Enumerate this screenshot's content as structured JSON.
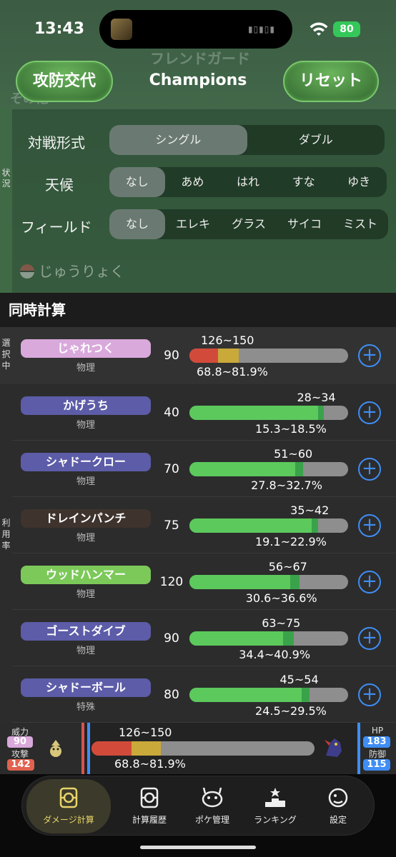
{
  "status_bar": {
    "time": "13:43",
    "battery": "80"
  },
  "background_ghost": {
    "line1": "フレンドガード",
    "line2": "その他"
  },
  "header": {
    "swap_label": "攻防交代",
    "title": "Champions",
    "reset_label": "リセット"
  },
  "conditions": {
    "side_label": "状況",
    "battle_format": {
      "label": "対戦形式",
      "options": [
        "シングル",
        "ダブル"
      ],
      "selected": "シングル"
    },
    "weather": {
      "label": "天候",
      "options": [
        "なし",
        "あめ",
        "はれ",
        "すな",
        "ゆき"
      ],
      "selected": "なし"
    },
    "field": {
      "label": "フィールド",
      "options": [
        "なし",
        "エレキ",
        "グラス",
        "サイコ",
        "ミスト"
      ],
      "selected": "なし"
    },
    "gravity_label": "じゅうりょく"
  },
  "calc": {
    "title": "同時計算",
    "selected_label": "選択中",
    "usage_label": "利用率",
    "selected_move": {
      "name": "じゃれつく",
      "category": "物理",
      "power": "90",
      "range": "126~150",
      "percent": "68.8~81.9%",
      "min_frac": 0.188,
      "max_frac": 0.214,
      "color": "#d9a9db",
      "min_color": "#d24b3a",
      "max_color": "#c9a93a"
    },
    "moves": [
      {
        "name": "かげうち",
        "category": "物理",
        "power": "40",
        "range": "28~34",
        "percent": "15.3~18.5%",
        "min_frac": 0.813,
        "max_frac": 0.846,
        "color": "#5c5ca8"
      },
      {
        "name": "シャドークロー",
        "category": "物理",
        "power": "70",
        "range": "51~60",
        "percent": "27.8~32.7%",
        "min_frac": 0.667,
        "max_frac": 0.716,
        "color": "#5c5ca8"
      },
      {
        "name": "ドレインパンチ",
        "category": "物理",
        "power": "75",
        "range": "35~42",
        "percent": "19.1~22.9%",
        "min_frac": 0.771,
        "max_frac": 0.809,
        "color": "#3e332d"
      },
      {
        "name": "ウッドハンマー",
        "category": "物理",
        "power": "120",
        "range": "56~67",
        "percent": "30.6~36.6%",
        "min_frac": 0.634,
        "max_frac": 0.694,
        "color": "#7cc95a"
      },
      {
        "name": "ゴーストダイブ",
        "category": "物理",
        "power": "90",
        "range": "63~75",
        "percent": "34.4~40.9%",
        "min_frac": 0.591,
        "max_frac": 0.656,
        "color": "#5c5ca8"
      },
      {
        "name": "シャドーボール",
        "category": "特殊",
        "power": "80",
        "range": "45~54",
        "percent": "24.5~29.5%",
        "min_frac": 0.705,
        "max_frac": 0.755,
        "color": "#5c5ca8"
      }
    ]
  },
  "summary": {
    "power_label": "威力",
    "power": "90",
    "attack_label": "攻撃",
    "attack": "142",
    "range": "126~150",
    "percent": "68.8~81.9%",
    "min_frac": 0.188,
    "max_frac": 0.214,
    "hp_label": "HP",
    "hp": "183",
    "defense_label": "防御",
    "defense": "115"
  },
  "tabs": [
    {
      "label": "ダメージ計算",
      "icon": "damage-calc-icon",
      "active": true
    },
    {
      "label": "計算履歴",
      "icon": "history-icon",
      "active": false
    },
    {
      "label": "ポケ管理",
      "icon": "pokemon-manage-icon",
      "active": false
    },
    {
      "label": "ランキング",
      "icon": "ranking-icon",
      "active": false
    },
    {
      "label": "設定",
      "icon": "settings-icon",
      "active": false
    }
  ],
  "colors": {
    "bar_green": "#5cc95c",
    "bar_green_dark": "#3aa24a",
    "bar_empty": "#8e8e8e",
    "plus_blue": "#3f8df5",
    "accent_gold": "#e8d46a"
  }
}
